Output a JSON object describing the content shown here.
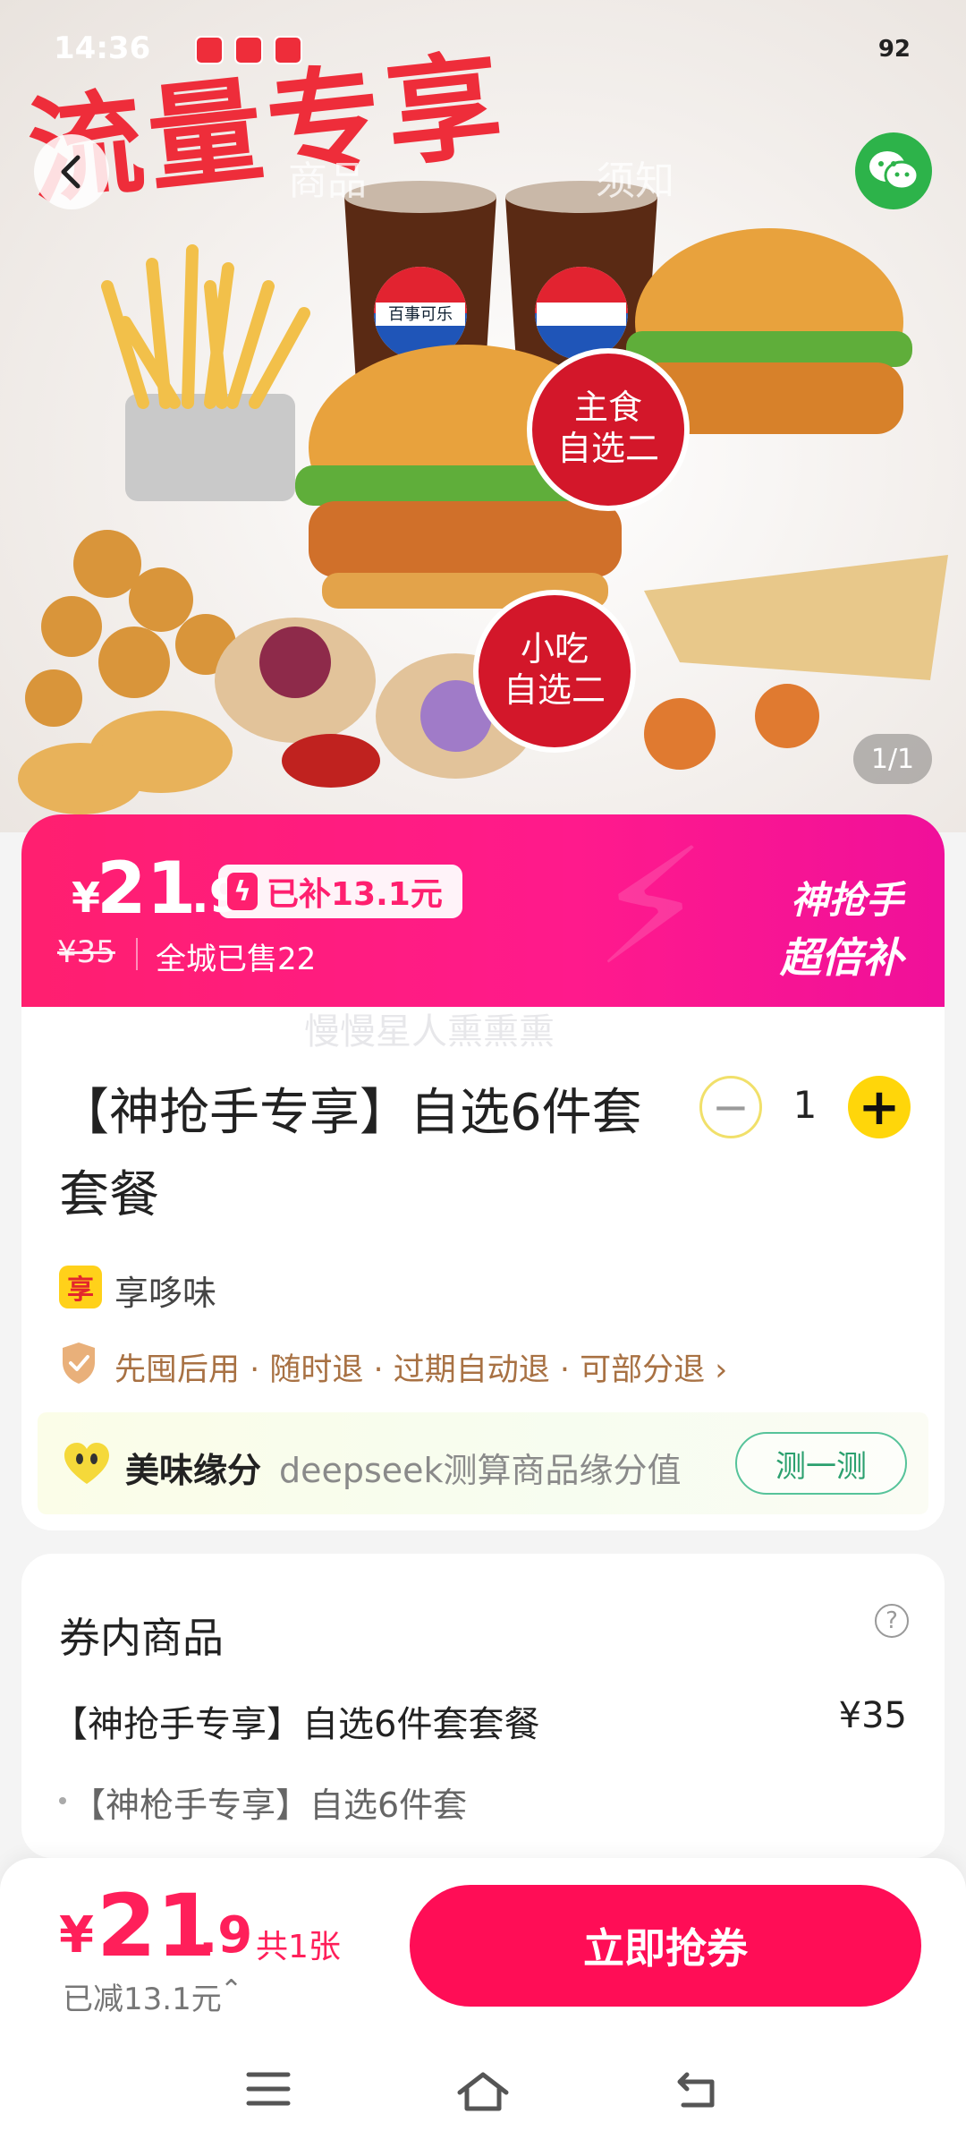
{
  "status_bar": {
    "time": "14:36",
    "battery": "92"
  },
  "hero": {
    "banner_text": "流量专享",
    "tabs": [
      "商品",
      "须知"
    ],
    "pager": "1/1",
    "labels": {
      "main": "主食自选二",
      "snack": "小吃自选二",
      "cola": "百事可乐"
    }
  },
  "price_banner": {
    "currency": "¥",
    "price_int": "21",
    "price_dec": ".9",
    "subsidy": "已补13.1元",
    "original_price": "¥35",
    "sold": "全城已售22",
    "tag_line1": "神抢手",
    "tag_line2": "超倍补"
  },
  "watermark": "慢慢星人熏熏熏",
  "product": {
    "title": "【神抢手专享】自选6件套套餐",
    "quantity": "1",
    "merchant": "享哆味",
    "guarantee": "先囤后用 · 随时退 · 过期自动退 · 可部分退",
    "fate_title": "美味缘分",
    "fate_desc": "deepseek测算商品缘分值",
    "fate_button": "测一测"
  },
  "coupon": {
    "title": "券内商品",
    "item_name": "【神抢手专享】自选6件套套餐",
    "item_price": "¥35",
    "sub_item": "【神枪手专享】自选6件套"
  },
  "bottom": {
    "currency": "¥",
    "price_int": "21",
    "price_dec": ".9",
    "count": "共1张",
    "saved": "已减13.1元",
    "buy_button": "立即抢券"
  },
  "colors": {
    "accent": "#ff0d56",
    "pink": "#ff1f6f",
    "yellow": "#ffd60a",
    "green": "#2db34a"
  }
}
